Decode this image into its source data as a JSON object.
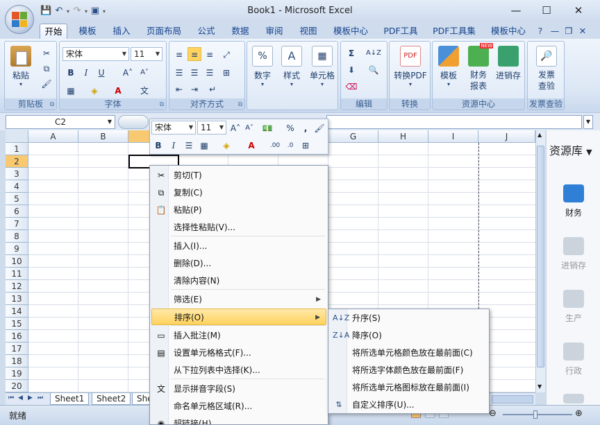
{
  "window": {
    "title": "Book1 - Microsoft Excel",
    "minimize": "—",
    "maximize": "☐",
    "close": "✕"
  },
  "qat": {
    "save": "💾",
    "undo": "↶",
    "redo": "↷",
    "more": "▾"
  },
  "tabs": [
    "开始",
    "模板",
    "插入",
    "页面布局",
    "公式",
    "数据",
    "审阅",
    "视图",
    "模板中心",
    "PDF工具",
    "PDF工具集",
    "模板中心"
  ],
  "ribbon_controls": {
    "help": "?",
    "min": "—",
    "restore": "❐",
    "close": "✕"
  },
  "ribbon": {
    "clipboard": {
      "caption": "剪贴板",
      "paste": "粘贴"
    },
    "font": {
      "caption": "字体",
      "name": "宋体",
      "size": "11",
      "bold": "B",
      "italic": "I",
      "underline": "U",
      "grow": "A˄",
      "shrink": "A˅",
      "phonetic": "文"
    },
    "align": {
      "caption": "对齐方式"
    },
    "number": {
      "label": "数字"
    },
    "style": {
      "label": "样式"
    },
    "cells": {
      "label": "单元格"
    },
    "edit": {
      "caption": "编辑",
      "sum": "Σ",
      "sort": "A↓Z"
    },
    "convert": {
      "caption": "转换",
      "label": "转换PDF"
    },
    "resource": {
      "caption": "资源中心",
      "template": "模板",
      "finance": "财务报表",
      "inventory": "进销存",
      "new_badge": "NEW"
    },
    "invoice": {
      "caption": "发票查验",
      "label": "发票查验"
    }
  },
  "namebox": "C2",
  "columns": [
    "A",
    "B",
    "C",
    "D",
    "E",
    "F",
    "G",
    "H",
    "I",
    "J"
  ],
  "rows": [
    "1",
    "2",
    "3",
    "4",
    "5",
    "6",
    "7",
    "8",
    "9",
    "10",
    "11",
    "12",
    "13",
    "14",
    "15",
    "16",
    "17",
    "18",
    "19",
    "20"
  ],
  "sheets": [
    "Sheet1",
    "Sheet2",
    "She"
  ],
  "status": "就绪",
  "sidebar": {
    "title": "资源库",
    "items": [
      "财务",
      "进销存",
      "生产",
      "行政"
    ]
  },
  "minibar": {
    "font": "宋体",
    "size": "11",
    "percent": "%",
    "comma": ",",
    "bold": "B",
    "italic": "I",
    "inc_dec": ".00",
    "dec_dec": ".0"
  },
  "context_menu": [
    {
      "label": "剪切(T)",
      "icon": "✂"
    },
    {
      "label": "复制(C)",
      "icon": "⧉"
    },
    {
      "label": "粘贴(P)",
      "icon": "📋"
    },
    {
      "label": "选择性粘贴(V)...",
      "icon": ""
    },
    {
      "label": "插入(I)...",
      "icon": ""
    },
    {
      "label": "删除(D)...",
      "icon": ""
    },
    {
      "label": "清除内容(N)",
      "icon": ""
    },
    {
      "label": "筛选(E)",
      "icon": "",
      "sub": true
    },
    {
      "label": "排序(O)",
      "icon": "",
      "sub": true
    },
    {
      "label": "插入批注(M)",
      "icon": "▭"
    },
    {
      "label": "设置单元格格式(F)...",
      "icon": "▤"
    },
    {
      "label": "从下拉列表中选择(K)...",
      "icon": ""
    },
    {
      "label": "显示拼音字段(S)",
      "icon": "文"
    },
    {
      "label": "命名单元格区域(R)...",
      "icon": ""
    },
    {
      "label": "超链接(H)...",
      "icon": "◉"
    }
  ],
  "sort_submenu": [
    {
      "label": "升序(S)",
      "icon": "A↓Z"
    },
    {
      "label": "降序(O)",
      "icon": "Z↓A"
    },
    {
      "label": "将所选单元格颜色放在最前面(C)",
      "icon": ""
    },
    {
      "label": "将所选字体颜色放在最前面(F)",
      "icon": ""
    },
    {
      "label": "将所选单元格图标放在最前面(I)",
      "icon": ""
    },
    {
      "label": "自定义排序(U)...",
      "icon": "⇅"
    }
  ]
}
